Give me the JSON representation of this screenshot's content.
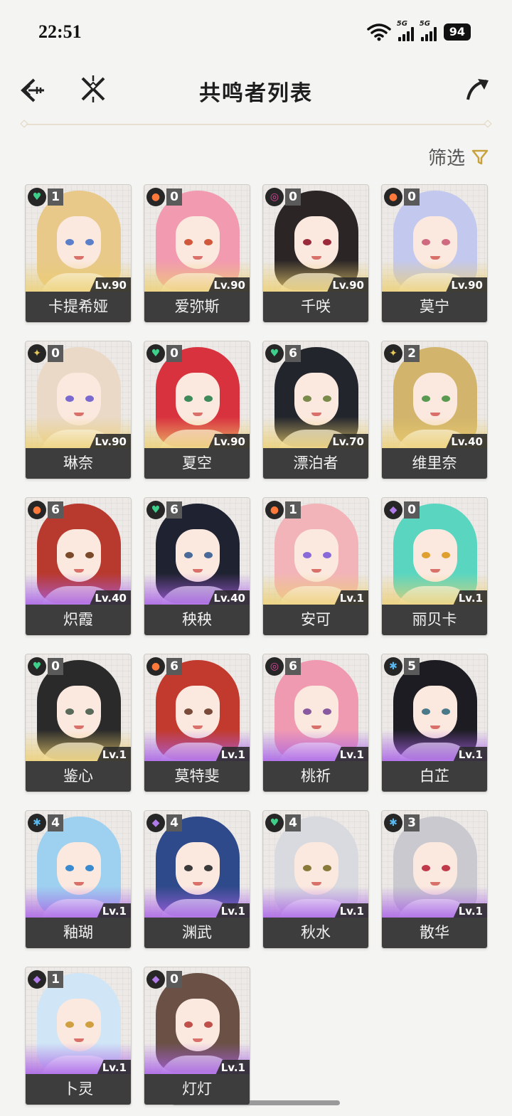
{
  "status_bar": {
    "time": "22:51",
    "signal1_label": "5G",
    "signal2_label": "5G",
    "battery": "94"
  },
  "header": {
    "title": "共鸣者列表",
    "back_icon": "back-arrow-icon",
    "close_icon": "cross-icon",
    "share_icon": "share-arrow-icon"
  },
  "filter": {
    "label": "筛选",
    "icon": "funnel-icon",
    "accent_color": "#c8a23c"
  },
  "element_colors": {
    "aero": "#3ed08a",
    "fusion": "#ff7a3a",
    "havoc": "#e04aa0",
    "spectro": "#e7c85a",
    "electro": "#b07ae8",
    "glacio": "#5ab8f0"
  },
  "characters": [
    {
      "name": "卡提希娅",
      "level": "Lv.90",
      "sequence": "1",
      "element": "aero",
      "rarity": 5,
      "hair": "#e8c98a",
      "eye": "#5b7fc9"
    },
    {
      "name": "爱弥斯",
      "level": "Lv.90",
      "sequence": "0",
      "element": "fusion",
      "rarity": 5,
      "hair": "#f29ab0",
      "eye": "#d1583a"
    },
    {
      "name": "千咲",
      "level": "Lv.90",
      "sequence": "0",
      "element": "havoc",
      "rarity": 5,
      "hair": "#2b2526",
      "eye": "#9b2a3a"
    },
    {
      "name": "莫宁",
      "level": "Lv.90",
      "sequence": "0",
      "element": "fusion",
      "rarity": 5,
      "hair": "#c3c8ee",
      "eye": "#d06a80"
    },
    {
      "name": "琳奈",
      "level": "Lv.90",
      "sequence": "0",
      "element": "spectro",
      "rarity": 5,
      "hair": "#ead9c6",
      "eye": "#7a6ad0"
    },
    {
      "name": "夏空",
      "level": "Lv.90",
      "sequence": "0",
      "element": "aero",
      "rarity": 5,
      "hair": "#d9323f",
      "eye": "#3f8a5a"
    },
    {
      "name": "漂泊者",
      "level": "Lv.70",
      "sequence": "6",
      "element": "aero",
      "rarity": 5,
      "hair": "#23252d",
      "eye": "#7a8a4a"
    },
    {
      "name": "维里奈",
      "level": "Lv.40",
      "sequence": "2",
      "element": "spectro",
      "rarity": 5,
      "hair": "#d2b46c",
      "eye": "#5a9a50"
    },
    {
      "name": "炽霞",
      "level": "Lv.40",
      "sequence": "6",
      "element": "fusion",
      "rarity": 4,
      "hair": "#b8392e",
      "eye": "#7a4a2a"
    },
    {
      "name": "秧秧",
      "level": "Lv.40",
      "sequence": "6",
      "element": "aero",
      "rarity": 4,
      "hair": "#1f2230",
      "eye": "#4a6a9a"
    },
    {
      "name": "安可",
      "level": "Lv.1",
      "sequence": "1",
      "element": "fusion",
      "rarity": 5,
      "hair": "#f2b4b8",
      "eye": "#8a6ad8"
    },
    {
      "name": "丽贝卡",
      "level": "Lv.1",
      "sequence": "0",
      "element": "electro",
      "rarity": 5,
      "hair": "#5ad6c0",
      "eye": "#e0a030"
    },
    {
      "name": "鉴心",
      "level": "Lv.1",
      "sequence": "0",
      "element": "aero",
      "rarity": 5,
      "hair": "#2a2a2a",
      "eye": "#5a6a5a"
    },
    {
      "name": "莫特斐",
      "level": "Lv.1",
      "sequence": "6",
      "element": "fusion",
      "rarity": 4,
      "hair": "#c23a2e",
      "eye": "#7a4a3a"
    },
    {
      "name": "桃祈",
      "level": "Lv.1",
      "sequence": "6",
      "element": "havoc",
      "rarity": 4,
      "hair": "#f09ab2",
      "eye": "#8a5aa0"
    },
    {
      "name": "白芷",
      "level": "Lv.1",
      "sequence": "5",
      "element": "glacio",
      "rarity": 4,
      "hair": "#1c1c22",
      "eye": "#4a7a8a"
    },
    {
      "name": "釉瑚",
      "level": "Lv.1",
      "sequence": "4",
      "element": "glacio",
      "rarity": 4,
      "hair": "#9ed0f0",
      "eye": "#3a8ad0"
    },
    {
      "name": "渊武",
      "level": "Lv.1",
      "sequence": "4",
      "element": "electro",
      "rarity": 4,
      "hair": "#2f4a8a",
      "eye": "#3a3a3a"
    },
    {
      "name": "秋水",
      "level": "Lv.1",
      "sequence": "4",
      "element": "aero",
      "rarity": 4,
      "hair": "#d8dadf",
      "eye": "#8a7a3a"
    },
    {
      "name": "散华",
      "level": "Lv.1",
      "sequence": "3",
      "element": "glacio",
      "rarity": 4,
      "hair": "#c9c9cf",
      "eye": "#c03a4a"
    },
    {
      "name": "卜灵",
      "level": "Lv.1",
      "sequence": "1",
      "element": "electro",
      "rarity": 4,
      "hair": "#d0e6f6",
      "eye": "#d0a040"
    },
    {
      "name": "灯灯",
      "level": "Lv.1",
      "sequence": "0",
      "element": "electro",
      "rarity": 4,
      "hair": "#6a5045",
      "eye": "#c0504a"
    }
  ]
}
